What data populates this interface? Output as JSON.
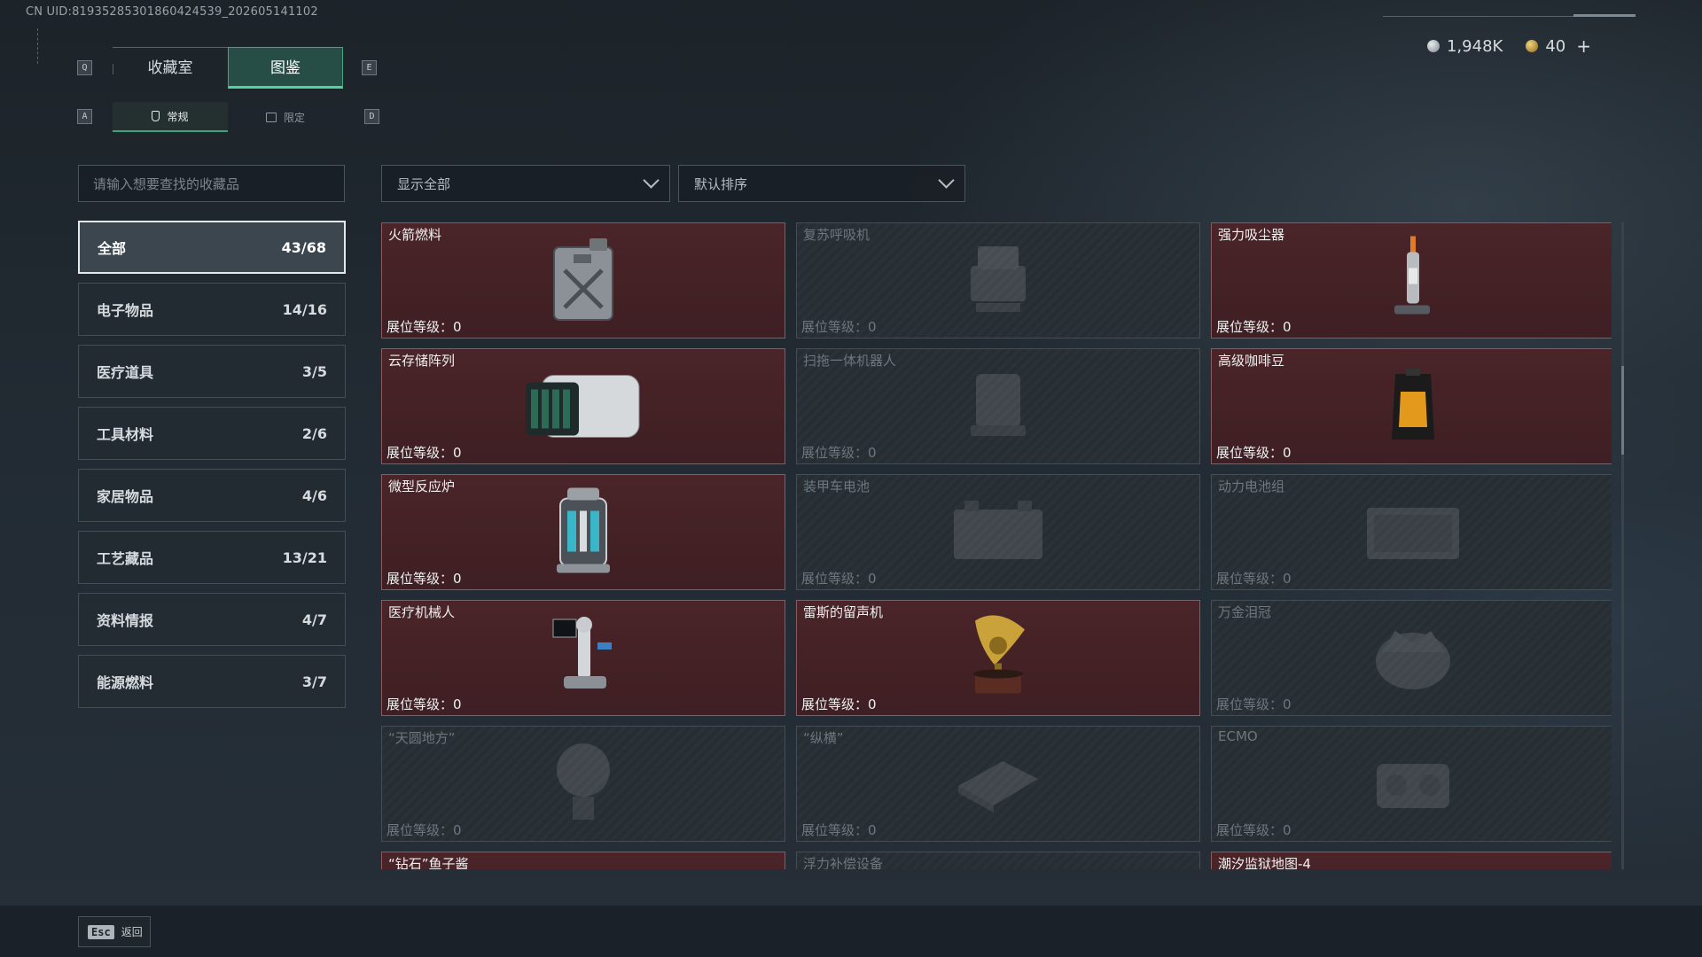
{
  "uid": "CN UID:8193528530186042453​9_202605141102",
  "currency": {
    "silver": "1,948K",
    "gold": "40",
    "add": "+"
  },
  "keys": {
    "prev_tab": "Q",
    "next_tab": "E",
    "prev_sub": "A",
    "next_sub": "D"
  },
  "main_tabs": [
    {
      "label": "收藏室"
    },
    {
      "label": "图鉴"
    }
  ],
  "sub_tabs": [
    {
      "label": "常规"
    },
    {
      "label": "限定"
    }
  ],
  "search": {
    "placeholder": "请输入想要查找的收藏品"
  },
  "filter": {
    "value": "显示全部"
  },
  "sort": {
    "value": "默认排序"
  },
  "categories": [
    {
      "label": "全部",
      "count": "43/68"
    },
    {
      "label": "电子物品",
      "count": "14/16"
    },
    {
      "label": "医疗道具",
      "count": "3/5"
    },
    {
      "label": "工具材料",
      "count": "2/6"
    },
    {
      "label": "家居物品",
      "count": "4/6"
    },
    {
      "label": "工艺藏品",
      "count": "13/21"
    },
    {
      "label": "资料情报",
      "count": "4/7"
    },
    {
      "label": "能源燃料",
      "count": "3/7"
    }
  ],
  "level_label": "展位等级：",
  "items": [
    {
      "name": "火箭燃料",
      "level": "0",
      "owned": true,
      "icon": "fuel-can"
    },
    {
      "name": "复苏呼吸机",
      "level": "0",
      "owned": false,
      "icon": "ventilator"
    },
    {
      "name": "强力吸尘器",
      "level": "0",
      "owned": true,
      "icon": "vacuum-cleaner"
    },
    {
      "name": "云存储阵列",
      "level": "0",
      "owned": true,
      "icon": "storage-array"
    },
    {
      "name": "扫拖一体机器人",
      "level": "0",
      "owned": false,
      "icon": "mop-robot"
    },
    {
      "name": "高级咖啡豆",
      "level": "0",
      "owned": true,
      "icon": "coffee-bag"
    },
    {
      "name": "微型反应炉",
      "level": "0",
      "owned": true,
      "icon": "mini-reactor"
    },
    {
      "name": "装甲车电池",
      "level": "0",
      "owned": false,
      "icon": "armored-battery"
    },
    {
      "name": "动力电池组",
      "level": "0",
      "owned": false,
      "icon": "power-battery-pack"
    },
    {
      "name": "医疗机械人",
      "level": "0",
      "owned": true,
      "icon": "medical-robot"
    },
    {
      "name": "雷斯的留声机",
      "level": "0",
      "owned": true,
      "icon": "gramophone"
    },
    {
      "name": "万金泪冠",
      "level": "0",
      "owned": false,
      "icon": "tear-crown"
    },
    {
      "name": "“天圆地方”",
      "level": "0",
      "owned": false,
      "icon": "round-sky-square-earth"
    },
    {
      "name": "“纵横”",
      "level": "0",
      "owned": false,
      "icon": "zongheng-board"
    },
    {
      "name": "ECMO",
      "level": "0",
      "owned": false,
      "icon": "ecmo-machine"
    },
    {
      "name": "“钻石”鱼子酱",
      "level": "",
      "owned": true,
      "icon": "caviar"
    },
    {
      "name": "浮力补偿设备",
      "level": "",
      "owned": false,
      "icon": "bcd-vest"
    },
    {
      "name": "潮汐监狱地图-4",
      "level": "",
      "owned": true,
      "icon": "map"
    }
  ],
  "back": {
    "key": "Esc",
    "label": "返回"
  },
  "colors": {
    "owned_bg": "#45222a",
    "accent_green": "#4fd39b",
    "locked_bg": "#283036"
  }
}
